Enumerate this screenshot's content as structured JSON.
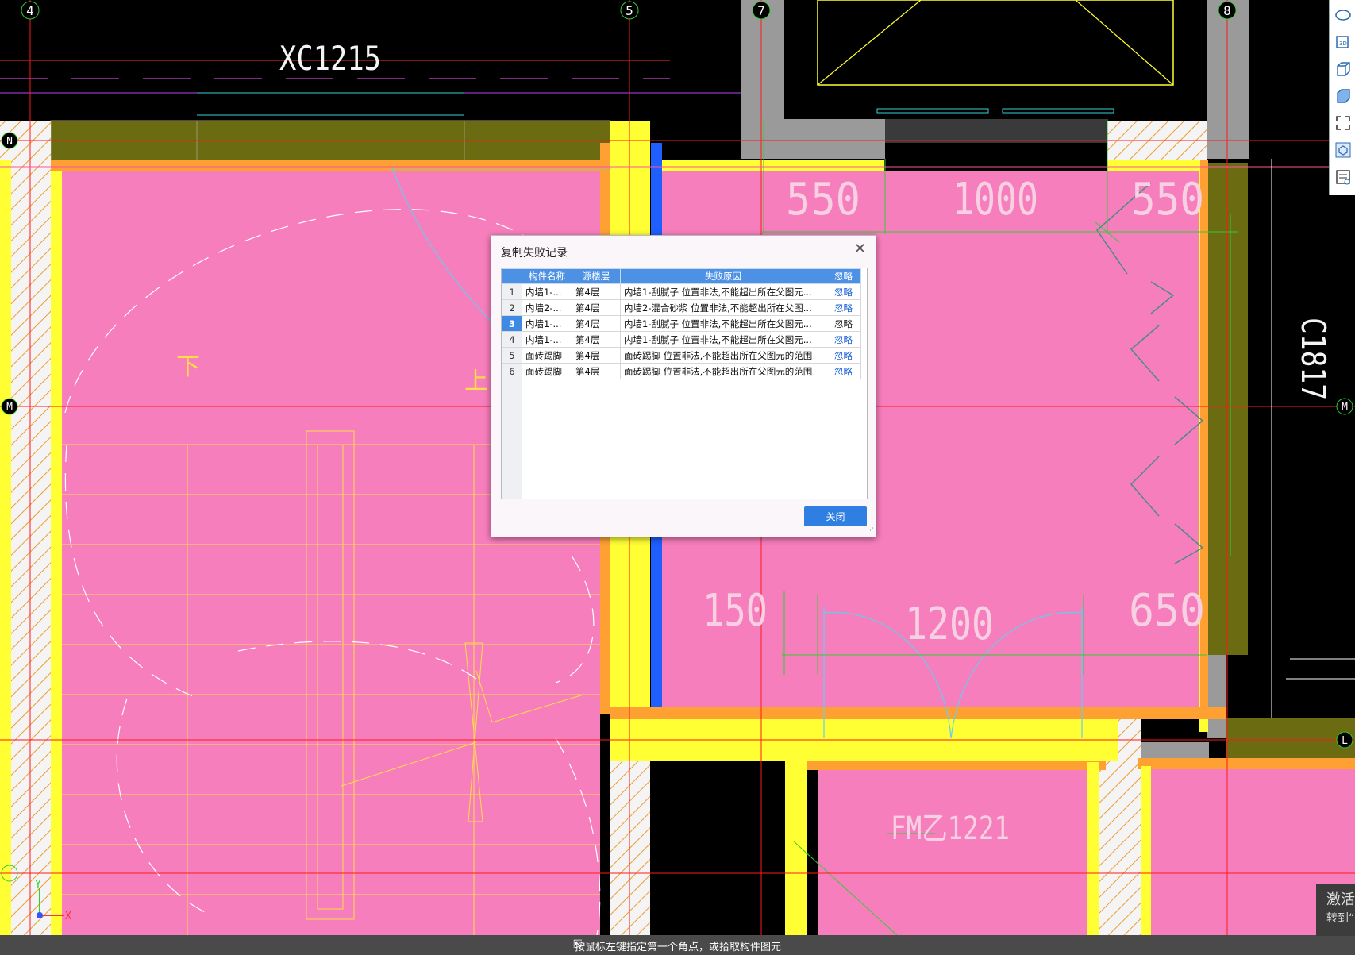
{
  "canvas": {
    "axis_labels": {
      "top": [
        "4",
        "5",
        "7",
        "8"
      ],
      "left": [
        "N",
        "M"
      ],
      "right": [
        "M",
        "L"
      ]
    },
    "texts": {
      "window_top": "XC1215",
      "dims_top": [
        "550",
        "1000",
        "550"
      ],
      "window_right": "C1817",
      "dims_bottom": [
        "150",
        "1200",
        "650"
      ],
      "door_bottom": "FM乙1221",
      "stair_down": "下",
      "stair_up": "上"
    },
    "coord_axes": {
      "x": "X",
      "y": "Y"
    },
    "colors": {
      "room_fill": "#f77ebc",
      "wall_yellow": "#ffff33",
      "wall_olive": "#6b6b12",
      "axis_red": "#ff1a1a",
      "bg": "#000000"
    }
  },
  "toolbar": {
    "icons": [
      "view-orbit-icon",
      "3d-view-icon",
      "box-view-icon",
      "solid-view-icon",
      "zoom-extents-icon",
      "element-display-icon",
      "property-list-icon"
    ]
  },
  "dialog": {
    "title": "复制失败记录",
    "columns": [
      "构件名称",
      "源楼层",
      "失败原因",
      "忽略"
    ],
    "rows": [
      {
        "no": "1",
        "name": "内墙1-...",
        "floor": "第4层",
        "reason": "内墙1-刮腻子 位置非法,不能超出所在父图元...",
        "action": "忽略"
      },
      {
        "no": "2",
        "name": "内墙2-...",
        "floor": "第4层",
        "reason": "内墙2-混合砂浆 位置非法,不能超出所在父图...",
        "action": "忽略"
      },
      {
        "no": "3",
        "name": "内墙1-...",
        "floor": "第4层",
        "reason": "内墙1-刮腻子 位置非法,不能超出所在父图元...",
        "action": "忽略"
      },
      {
        "no": "4",
        "name": "内墙1-...",
        "floor": "第4层",
        "reason": "内墙1-刮腻子 位置非法,不能超出所在父图元...",
        "action": "忽略"
      },
      {
        "no": "5",
        "name": "面砖踢脚",
        "floor": "第4层",
        "reason": "面砖踢脚 位置非法,不能超出所在父图元的范围",
        "action": "忽略"
      },
      {
        "no": "6",
        "name": "面砖踢脚",
        "floor": "第4层",
        "reason": "面砖踢脚 位置非法,不能超出所在父图元的范围",
        "action": "忽略"
      }
    ],
    "selected_row": 3,
    "close_label": "关闭"
  },
  "status_bar": {
    "text": "按鼠标左键指定第一个角点，或拾取构件图元"
  },
  "activation": {
    "line1": "激活",
    "line2": "转到“"
  }
}
